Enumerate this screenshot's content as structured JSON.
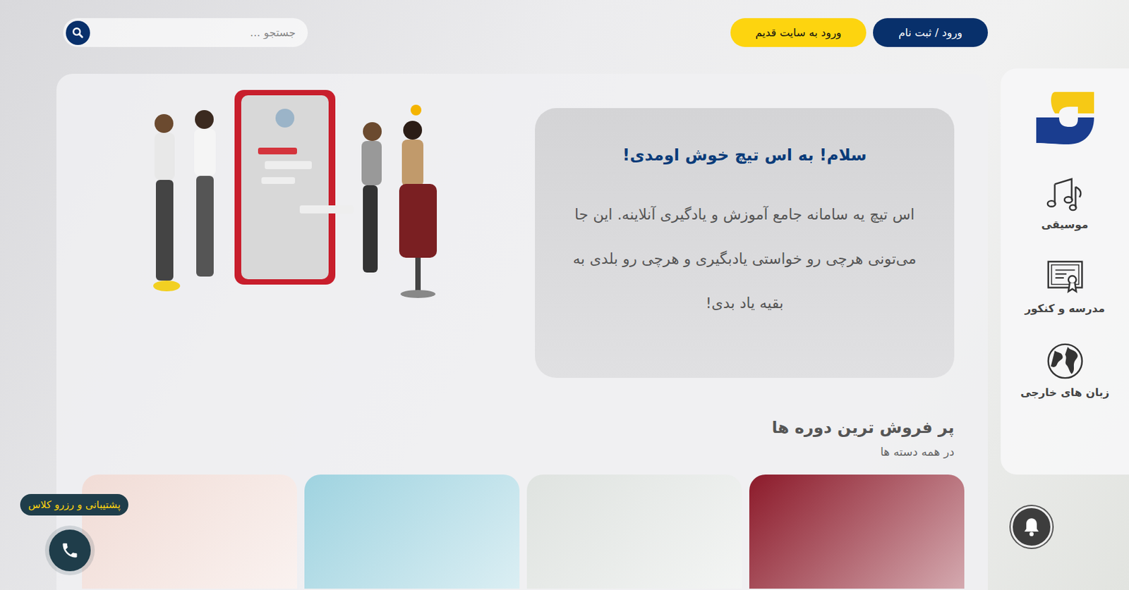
{
  "header": {
    "search": {
      "placeholder": "جستجو ..."
    },
    "buttons": [
      {
        "label": "ورود / ثبت نام",
        "kind": "primary"
      },
      {
        "label": "ورود به سایت قدیم",
        "kind": "secondary"
      }
    ]
  },
  "sidebar": {
    "items": [
      {
        "label": "موسیقی",
        "kind": "music"
      },
      {
        "label": "مدرسه و کنکور",
        "kind": "school"
      },
      {
        "label": "زبان های خارجی",
        "kind": "languages"
      }
    ]
  },
  "hero": {
    "title": "سلام! به اس تیچ خوش اومدی!",
    "text": "اس تیچ یه سامانه جامع آموزش و یادگیری آنلاینه. این جا می‌تونی هرچی رو خواستی یادبگیری و هرچی رو بلدی به بقیه یاد بدی!"
  },
  "section": {
    "title": "پر فروش ترین دوره ها",
    "subtitle": "در همه دسته ها"
  },
  "courses": [
    {
      "color": "#8c1a2a"
    },
    {
      "color": "#dfe3e0"
    },
    {
      "color": "#9fd3e0"
    },
    {
      "color": "#f1dcd6"
    }
  ],
  "support": {
    "label": "پشتیبانی و رزرو کلاس"
  }
}
